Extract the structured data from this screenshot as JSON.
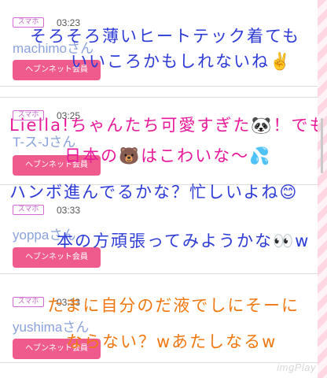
{
  "posts": [
    {
      "device": "スマホ",
      "time": "03:23",
      "username": "machimoさん",
      "member_button": "ヘブンネット会員",
      "overlay_lines": [
        "そろそろ薄いヒートテック着ても",
        "いいころかもしれないね✌️"
      ],
      "overlay_color": "#2d3bd6"
    },
    {
      "device": "スマホ",
      "time": "03:25",
      "username": "T-ス-Jさん",
      "member_button": "ヘブンネット会員",
      "overlay_lines": [
        "Liella!ちゃんたち可愛すぎた🐼！でも",
        "日本の🐻はこわいな〜💦"
      ],
      "overlay_color": "#e8189a"
    },
    {
      "device": "スマホ",
      "time": "03:33",
      "username": "yoppaさん",
      "member_button": "ヘブンネット会員",
      "overlay_lines": [
        "ハンボ進んでるかな？忙しいよね😊",
        "本の方頑張ってみようかな👀w"
      ],
      "overlay_color": "#2d3bd6"
    },
    {
      "device": "スマホ",
      "time": "03:33",
      "username": "yushimaさん",
      "member_button": "ヘブンネット会員",
      "overlay_lines": [
        "たまに自分のだ液でしにそーに",
        "ならない？wあたしなるw"
      ],
      "overlay_color": "#f07810"
    }
  ],
  "watermark": "imgPlay"
}
